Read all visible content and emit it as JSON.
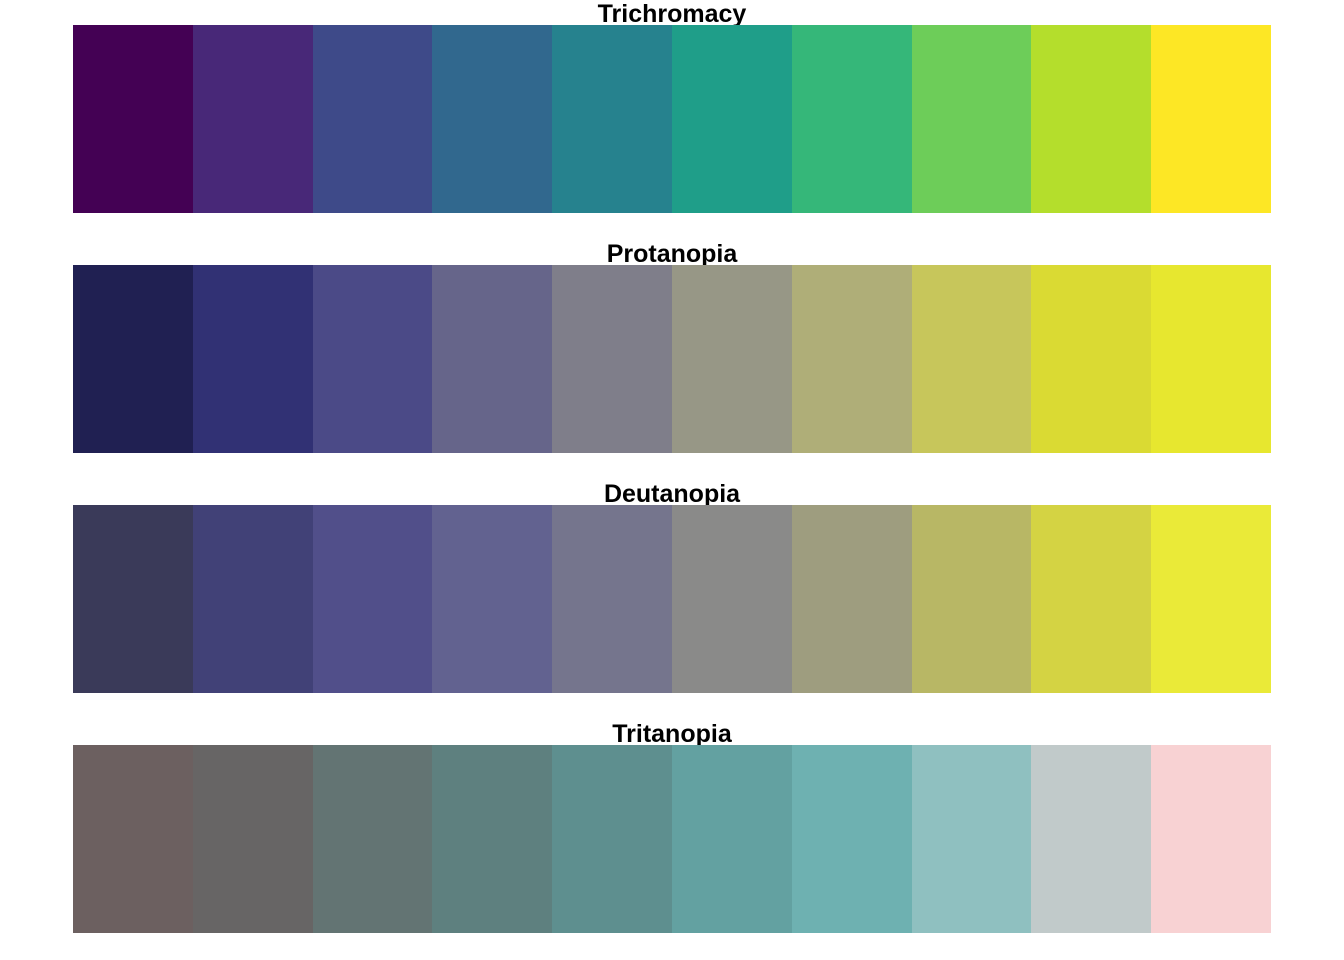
{
  "chart_data": {
    "type": "heatmap",
    "panels": [
      {
        "title": "Trichromacy",
        "colors": [
          "#440154",
          "#482878",
          "#3E4A89",
          "#31688E",
          "#26828E",
          "#1F9E89",
          "#35B779",
          "#6DCD59",
          "#B4DE2C",
          "#FDE725"
        ]
      },
      {
        "title": "Protanopia",
        "colors": [
          "#202052",
          "#313174",
          "#4B4A87",
          "#66658A",
          "#7F7E8A",
          "#979786",
          "#AFAE78",
          "#C7C65B",
          "#DADA33",
          "#E7E72F"
        ]
      },
      {
        "title": "Deutanopia",
        "colors": [
          "#3A3A59",
          "#414177",
          "#514F8A",
          "#626290",
          "#75758D",
          "#8A8A89",
          "#9E9D7F",
          "#B8B765",
          "#D4D343",
          "#EAEA38"
        ]
      },
      {
        "title": "Tritanopia",
        "colors": [
          "#6C6060",
          "#676565",
          "#637473",
          "#5E807F",
          "#5E8F8F",
          "#63A1A1",
          "#6EB1B1",
          "#8FC0C0",
          "#C1CACA",
          "#F8D2D3"
        ]
      }
    ]
  }
}
